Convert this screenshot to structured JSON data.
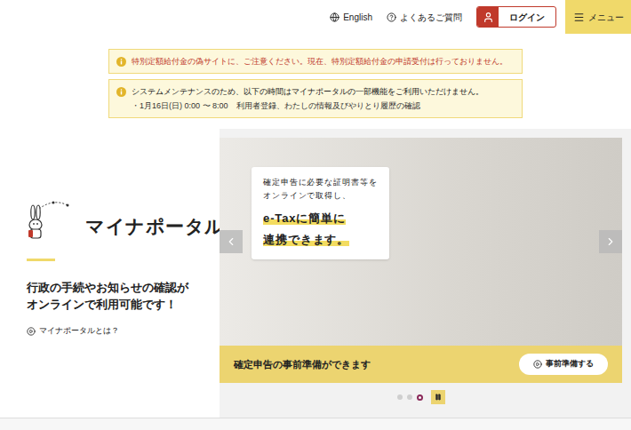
{
  "header": {
    "language": "English",
    "faq": "よくあるご質問",
    "login": "ログイン",
    "menu": "メニュー"
  },
  "notices": [
    {
      "kind": "alert",
      "text": "特別定額給付金の偽サイトに、ご注意ください。現在、特別定額給付金の申請受付は行っておりません。",
      "details": []
    },
    {
      "kind": "info",
      "text": "システムメンテナンスのため、以下の時間はマイナポータルの一部機能をご利用いただけません。",
      "details": [
        "・1月16日(日) 0:00 〜 8:00　利用者登録、わたしの情報及びやりとり履歴の確認"
      ]
    }
  ],
  "intro": {
    "logo": "マイナポータル",
    "tagline": [
      "行政の手続やお知らせの確認が",
      "オンラインで利用可能です！"
    ],
    "link": "マイナポータルとは？"
  },
  "carousel": {
    "caption": [
      "確定申告に必要な証明書等を",
      "オンラインで取得し、"
    ],
    "highlight": [
      "e-Taxに簡単に",
      "連携できます。"
    ],
    "banner": "確定申告の事前準備ができます",
    "button": "事前準備する",
    "slides": [
      {
        "selected": false
      },
      {
        "selected": false
      },
      {
        "selected": true
      }
    ],
    "playing": true
  }
}
